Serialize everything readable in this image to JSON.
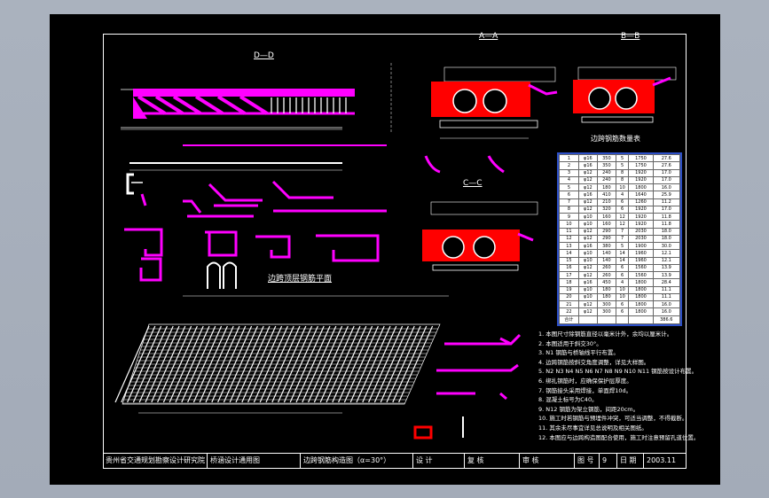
{
  "colors": {
    "background": "#000000",
    "frame": "#ffffff",
    "magenta": "#ff00ff",
    "red": "#ff0000",
    "table_border": "#2d50c8"
  },
  "views": {
    "dd_title": "D—D",
    "aa_title": "A—A",
    "bb_title": "B—B",
    "cc_title": "C—C",
    "plan_title": "边跨顶层钢筋平面",
    "table_title": "边跨钢筋数量表"
  },
  "rebar_table": {
    "rows": [
      [
        "1",
        "φ16",
        "350",
        "5",
        "1750",
        "27.6"
      ],
      [
        "2",
        "φ16",
        "350",
        "5",
        "1750",
        "27.6"
      ],
      [
        "3",
        "φ12",
        "240",
        "8",
        "1920",
        "17.0"
      ],
      [
        "4",
        "φ12",
        "240",
        "8",
        "1920",
        "17.0"
      ],
      [
        "5",
        "φ12",
        "180",
        "10",
        "1800",
        "16.0"
      ],
      [
        "6",
        "φ16",
        "410",
        "4",
        "1640",
        "25.9"
      ],
      [
        "7",
        "φ12",
        "210",
        "6",
        "1260",
        "11.2"
      ],
      [
        "8",
        "φ12",
        "320",
        "6",
        "1920",
        "17.0"
      ],
      [
        "9",
        "φ10",
        "160",
        "12",
        "1920",
        "11.8"
      ],
      [
        "10",
        "φ10",
        "160",
        "12",
        "1920",
        "11.8"
      ],
      [
        "11",
        "φ12",
        "290",
        "7",
        "2030",
        "18.0"
      ],
      [
        "12",
        "φ12",
        "290",
        "7",
        "2030",
        "18.0"
      ],
      [
        "13",
        "φ16",
        "380",
        "5",
        "1900",
        "30.0"
      ],
      [
        "14",
        "φ10",
        "140",
        "14",
        "1960",
        "12.1"
      ],
      [
        "15",
        "φ10",
        "140",
        "14",
        "1960",
        "12.1"
      ],
      [
        "16",
        "φ12",
        "260",
        "6",
        "1560",
        "13.9"
      ],
      [
        "17",
        "φ12",
        "260",
        "6",
        "1560",
        "13.9"
      ],
      [
        "18",
        "φ16",
        "450",
        "4",
        "1800",
        "28.4"
      ],
      [
        "19",
        "φ10",
        "180",
        "10",
        "1800",
        "11.1"
      ],
      [
        "20",
        "φ10",
        "180",
        "10",
        "1800",
        "11.1"
      ],
      [
        "21",
        "φ12",
        "300",
        "6",
        "1800",
        "16.0"
      ],
      [
        "22",
        "φ12",
        "300",
        "6",
        "1800",
        "16.0"
      ],
      [
        "合计",
        "",
        "",
        "",
        "",
        "386.6"
      ]
    ]
  },
  "notes": [
    "1. 本图尺寸除钢筋直径以毫米计外，余均以厘米计。",
    "2. 本图适用于斜交30°。",
    "3. N1 钢筋与桥轴线平行布置。",
    "4. 边跨钢筋按斜交角度调整，详见大样图。",
    "5. N2 N3 N4 N5 N6 N7 N8 N9 N10 N11 钢筋按设计布置。",
    "6. 绑扎钢筋时，应确保保护层厚度。",
    "7. 钢筋接头采用焊接，单面焊10d。",
    "8. 混凝土标号为C40。",
    "9. N12 钢筋为架立钢筋，间距20cm。",
    "10. 施工时若钢筋与预埋件冲突，可适当调整，不得截断。",
    "11. 其余未尽事宜详见总说明及相关图纸。",
    "12. 本图应与边跨构造图配合使用，施工时注意预留孔道位置。"
  ],
  "title_block": {
    "org": "贵州省交通规划勘察设计研究院",
    "project": "桥涵设计通用图",
    "drawing": "边跨钢筋构造图（α=30°）",
    "design": "设 计",
    "review": "复 核",
    "check": "审 核",
    "no_label": "图 号",
    "no_value": "9",
    "date_label": "日 期",
    "date_value": "2003.11"
  }
}
